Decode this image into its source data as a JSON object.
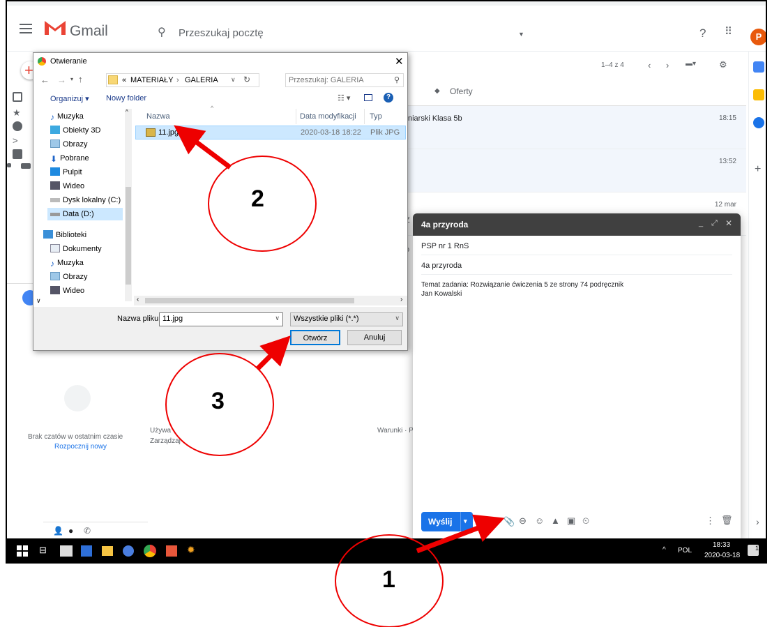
{
  "gmail": {
    "app_name": "Gmail",
    "search_placeholder": "Przeszukaj pocztę",
    "avatar_letter": "P",
    "pager": "1–4 z 4",
    "category_tab": "Oferty",
    "rows": [
      {
        "text": "niarski Klasa 5b",
        "time": "18:15"
      },
      {
        "text": "",
        "time": "13:52"
      },
      {
        "text": "",
        "time": "12 mar"
      }
    ],
    "chat_empty": "Brak czatów w ostatnim czasie",
    "chat_start": "Rozpocznij nowy",
    "footer_left1": "Używa",
    "footer_left2": "Zarządzaj",
    "footer_right": "Warunki · P",
    "partial_z": "Z",
    "partial_o": "o"
  },
  "dialog": {
    "title": "Otwieranie",
    "path_prefix": "«",
    "path_1": "MATERIAŁY",
    "path_sep": "›",
    "path_2": "GALERIA",
    "search_placeholder": "Przeszukaj: GALERIA",
    "organize": "Organizuj ▾",
    "new_folder": "Nowy folder",
    "nav_items": [
      "Muzyka",
      "Obiekty 3D",
      "Obrazy",
      "Pobrane",
      "Pulpit",
      "Wideo",
      "Dysk lokalny (C:)",
      "Data (D:)",
      "Biblioteki",
      "Dokumenty",
      "Muzyka",
      "Obrazy",
      "Wideo"
    ],
    "columns": {
      "name": "Nazwa",
      "date": "Data modyfikacji",
      "type": "Typ"
    },
    "file": {
      "name": "11.jpg",
      "date": "2020-03-18 18:22",
      "type": "Plik JPG"
    },
    "filename_label": "Nazwa pliku:",
    "filename_value": "11.jpg",
    "filter_value": "Wszystkie pliki (*.*)",
    "open_button": "Otwórz",
    "cancel_button": "Anuluj"
  },
  "compose": {
    "title": "4a przyroda",
    "to": "PSP nr 1 RnS",
    "subject": "4a przyroda",
    "body_line1": "Temat zadania: Rozwiązanie ćwiczenia 5 ze strony 74 podręcznik",
    "body_line2": "Jan Kowalski",
    "send": "Wyślij"
  },
  "taskbar": {
    "lang": "POL",
    "time": "18:33",
    "date": "2020-03-18",
    "notification_count": "1"
  },
  "annotations": [
    "1",
    "2",
    "3"
  ],
  "colors": {
    "accent": "#1a73e8",
    "annotation": "#e00000",
    "gmail_red": "#ea4335"
  }
}
